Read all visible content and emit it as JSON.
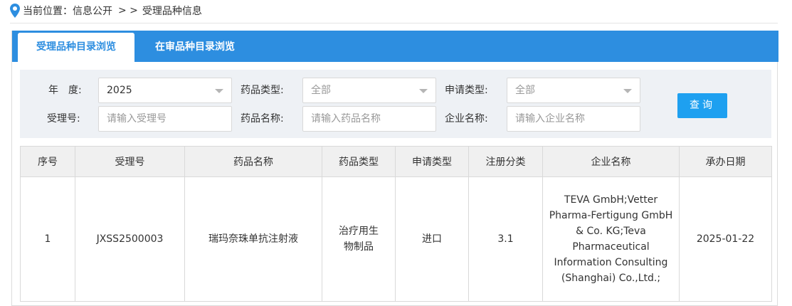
{
  "breadcrumb": {
    "prefix": "当前位置：",
    "crumbs": [
      "信息公开",
      "受理品种信息"
    ],
    "separator": "> >"
  },
  "tabs": [
    {
      "label": "受理品种目录浏览",
      "active": true
    },
    {
      "label": "在审品种目录浏览",
      "active": false
    }
  ],
  "filters": {
    "year": {
      "label": "年　度:",
      "value": "2025"
    },
    "drug_type": {
      "label": "药品类型:",
      "value": "全部"
    },
    "apply_type": {
      "label": "申请类型:",
      "value": "全部"
    },
    "accept_no": {
      "label": "受理号:",
      "placeholder": "请输入受理号"
    },
    "drug_name": {
      "label": "药品名称:",
      "placeholder": "请输入药品名称"
    },
    "company": {
      "label": "企业名称:",
      "placeholder": "请输入企业名称"
    },
    "query_label": "查询"
  },
  "table": {
    "headers": [
      "序号",
      "受理号",
      "药品名称",
      "药品类型",
      "申请类型",
      "注册分类",
      "企业名称",
      "承办日期"
    ],
    "rows": [
      {
        "index": "1",
        "accept_no": "JXSS2500003",
        "drug_name": "瑞玛奈珠单抗注射液",
        "drug_type": "治疗用生物制品",
        "apply_type": "进口",
        "reg_class": "3.1",
        "company": "TEVA GmbH;Vetter Pharma-Fertigung GmbH & Co. KG;Teva Pharmaceutical Information Consulting (Shanghai) Co.,Ltd.;",
        "date": "2025-01-22"
      }
    ]
  }
}
